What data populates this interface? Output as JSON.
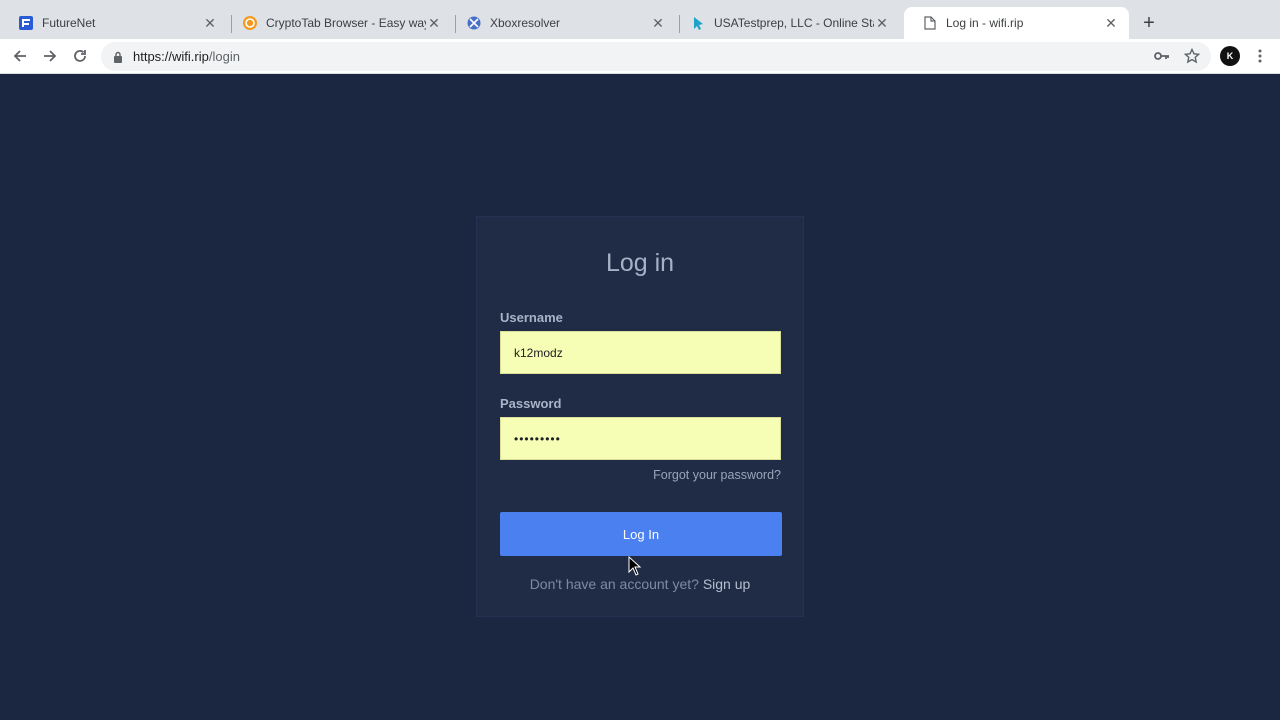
{
  "browser": {
    "tabs": [
      {
        "title": "FutureNet",
        "icon": "futurenet-favicon"
      },
      {
        "title": "CryptoTab Browser - Easy way",
        "icon": "cryptotab-favicon"
      },
      {
        "title": "Xboxresolver",
        "icon": "xboxresolver-favicon"
      },
      {
        "title": "USATestprep, LLC - Online Sta",
        "icon": "usatestprep-favicon"
      },
      {
        "title": "Log in - wifi.rip",
        "icon": "page-favicon",
        "active": true
      }
    ],
    "url_host": "https://wifi.rip",
    "url_path": "/login",
    "avatar_text": "K"
  },
  "login": {
    "title": "Log in",
    "username_label": "Username",
    "username_value": "k12modz",
    "password_label": "Password",
    "password_value": "•••••••••",
    "forgot_link": "Forgot your password?",
    "submit_label": "Log In",
    "signup_prompt": "Don't have an account yet?",
    "signup_link": "Sign up"
  },
  "colors": {
    "page_bg": "#1b2740",
    "card_bg": "#202c46",
    "button_bg": "#4a80f0",
    "autofill_bg": "#f6fdb5"
  }
}
